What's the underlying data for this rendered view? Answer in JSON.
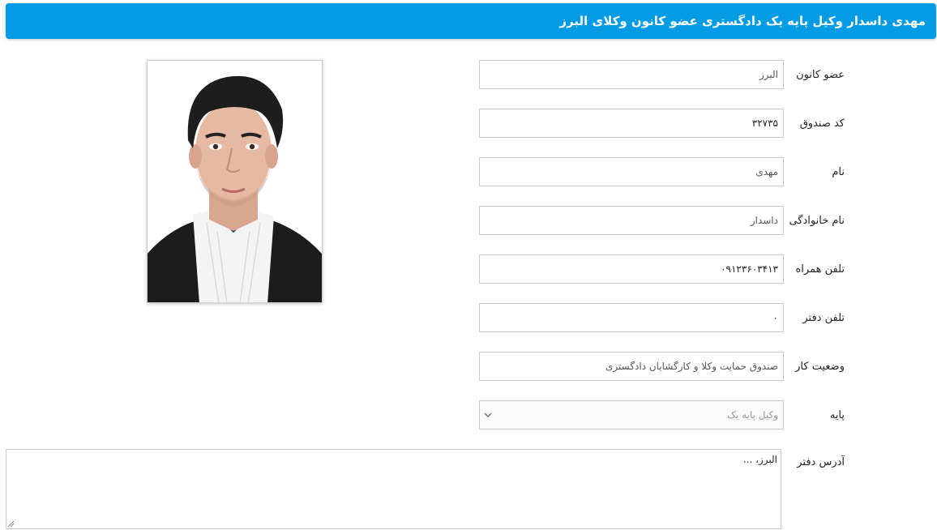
{
  "header": {
    "title": "مهدی داسدار وکیل پایه یک دادگستری عضو کانون وکلای البرز"
  },
  "fields": [
    {
      "label": "عضو کانون",
      "value": "البرز"
    },
    {
      "label": "کد صندوق",
      "value": "۳۲۷۳۵"
    },
    {
      "label": "نام",
      "value": "مهدی"
    },
    {
      "label": "نام خانوادگی",
      "value": "داسدار"
    },
    {
      "label": "تلفن همراه",
      "value": "۰۹۱۲۳۶۰۳۴۱۳"
    },
    {
      "label": "تلفن دفتر",
      "value": "۰"
    },
    {
      "label": "وضعیت کار",
      "value": "صندوق حمایت وکلا و کارگشایان دادگستری"
    }
  ],
  "grade": {
    "label": "پایه",
    "value": "وکیل پایه یک",
    "icon": "chevron-down-icon"
  },
  "address": {
    "label": "آدرس دفتر",
    "value": "البرز، ..."
  },
  "photo": {
    "icon": "profile-photo"
  },
  "colors": {
    "header_bg": "#049be5",
    "border": "#c9c9c9"
  }
}
